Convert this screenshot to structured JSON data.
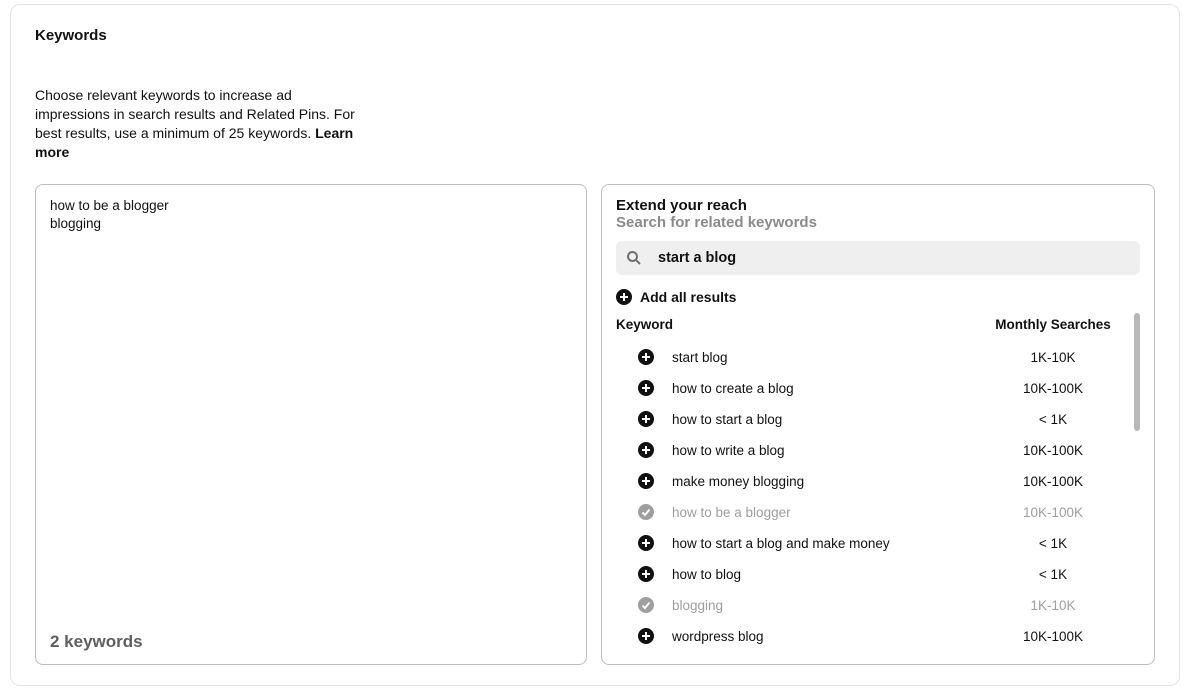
{
  "section": {
    "title": "Keywords",
    "description": "Choose relevant keywords to increase ad impressions in search results and Related Pins. For best results, use a minimum of 25 keywords. ",
    "learn_more": "Learn more"
  },
  "selected_keywords": {
    "items": [
      "how to be a blogger",
      "blogging"
    ],
    "count_label": "2 keywords"
  },
  "extend": {
    "title": "Extend your reach",
    "subtitle": "Search for related keywords",
    "search_value": "start a blog",
    "add_all_label": "Add all results",
    "col_keyword": "Keyword",
    "col_searches": "Monthly Searches",
    "results": [
      {
        "keyword": "start blog",
        "searches": "1K-10K",
        "state": "add"
      },
      {
        "keyword": "how to create a blog",
        "searches": "10K-100K",
        "state": "add"
      },
      {
        "keyword": "how to start a blog",
        "searches": "< 1K",
        "state": "add"
      },
      {
        "keyword": "how to write a blog",
        "searches": "10K-100K",
        "state": "add"
      },
      {
        "keyword": "make money blogging",
        "searches": "10K-100K",
        "state": "add"
      },
      {
        "keyword": "how to be a blogger",
        "searches": "10K-100K",
        "state": "added"
      },
      {
        "keyword": "how to start a blog and make money",
        "searches": "< 1K",
        "state": "add"
      },
      {
        "keyword": "how to blog",
        "searches": "< 1K",
        "state": "add"
      },
      {
        "keyword": "blogging",
        "searches": "1K-10K",
        "state": "added"
      },
      {
        "keyword": "wordpress blog",
        "searches": "10K-100K",
        "state": "add"
      }
    ]
  }
}
